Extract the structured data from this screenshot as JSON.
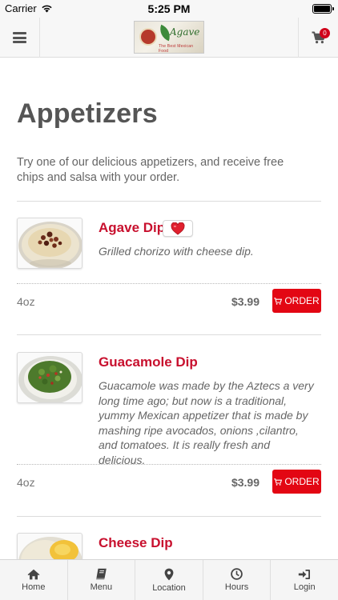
{
  "status_bar": {
    "carrier": "Carrier",
    "time": "5:25 PM"
  },
  "header": {
    "logo_text": "Agave",
    "logo_tagline": "The Best Mexican Food",
    "cart_count": "0"
  },
  "page": {
    "title": "Appetizers",
    "description": "Try one of our delicious appetizers, and receive free chips and salsa with your order."
  },
  "items": [
    {
      "name": "Agave Dip",
      "description": "Grilled chorizo with cheese dip.",
      "size": "4oz",
      "price": "$3.99",
      "order_label": "ORDER",
      "favorite": true
    },
    {
      "name": "Guacamole Dip",
      "description": "Guacamole was made by the Aztecs a very long time ago; but now is a traditional, yummy Mexican appetizer that is made by mashing ripe avocados, onions ,cilantro, and tomatoes. It is really fresh and delicious.",
      "size": "4oz",
      "price": "$3.99",
      "order_label": "ORDER"
    },
    {
      "name": "Cheese Dip"
    }
  ],
  "tab_bar": [
    {
      "label": "Home",
      "icon": "home-icon"
    },
    {
      "label": "Menu",
      "icon": "book-icon"
    },
    {
      "label": "Location",
      "icon": "map-pin-icon"
    },
    {
      "label": "Hours",
      "icon": "clock-icon"
    },
    {
      "label": "Login",
      "icon": "login-icon"
    }
  ],
  "colors": {
    "accent_red": "#e30613",
    "item_name_red": "#c8102e",
    "badge_red": "#d0021b",
    "header_bg": "#f7f7f7"
  }
}
